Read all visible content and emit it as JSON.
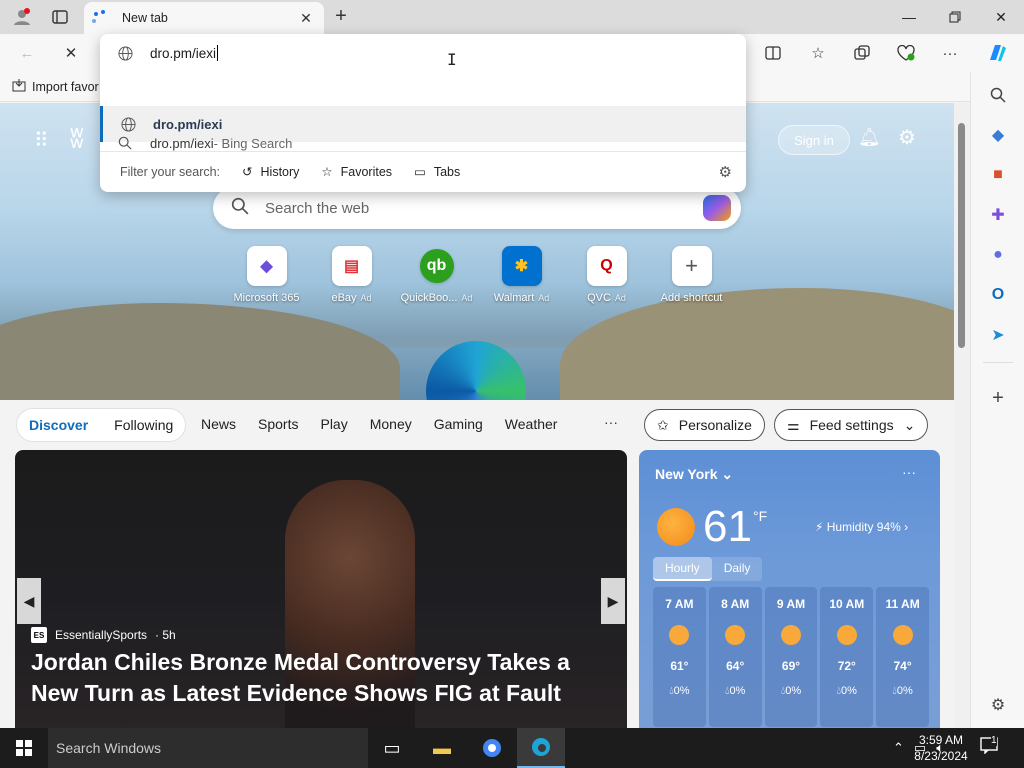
{
  "window": {
    "tab_title": "New tab",
    "new_tab_symbol": "+",
    "close_symbol": "✕"
  },
  "toolbar": {
    "back_symbol": "←",
    "stop_symbol": "✕",
    "more_symbol": "···"
  },
  "favorites_bar": {
    "import_label": "Import favor"
  },
  "omnibox": {
    "input_value": "dro.pm/iexi",
    "suggestions": [
      {
        "text": "dro.pm/iexi",
        "sub": ""
      },
      {
        "text": "dro.pm/iexi",
        "sub": " - Bing Search"
      }
    ],
    "filter_label": "Filter your search:",
    "filters": [
      "History",
      "Favorites",
      "Tabs"
    ]
  },
  "newtab": {
    "signin_label": "Sign in",
    "search_placeholder": "Search the web",
    "tiles": [
      {
        "label": "Microsoft 365",
        "ad": "",
        "glyph": "◆",
        "color": "#6b4fd8"
      },
      {
        "label": "eBay",
        "ad": "Ad",
        "glyph": "▤",
        "color": "#e53238"
      },
      {
        "label": "QuickBoo...",
        "ad": "Ad",
        "glyph": "qb",
        "color": "#2ca01c"
      },
      {
        "label": "Walmart",
        "ad": "Ad",
        "glyph": "✱",
        "color": "#0071ce"
      },
      {
        "label": "QVC",
        "ad": "Ad",
        "glyph": "Q",
        "color": "#c00"
      },
      {
        "label": "Add shortcut",
        "ad": "",
        "glyph": "+",
        "color": "#555"
      }
    ]
  },
  "feed": {
    "tabs": [
      "Discover",
      "Following"
    ],
    "links": [
      "News",
      "Sports",
      "Play",
      "Money",
      "Gaming",
      "Weather"
    ],
    "more": "···",
    "personalize": "Personalize",
    "feed_settings": "Feed settings"
  },
  "news": {
    "source": "EssentiallySports",
    "source_logo": "ES",
    "age": "· 5h",
    "headline": "Jordan Chiles Bronze Medal Controversy Takes a New Turn as Latest Evidence Shows FIG at Fault"
  },
  "weather": {
    "city": "New York",
    "temp": "61",
    "unit": "°F",
    "humidity": "Humidity 94%",
    "toggle": [
      "Hourly",
      "Daily"
    ],
    "hours": [
      {
        "time": "7 AM",
        "temp": "61°",
        "precip": "0%"
      },
      {
        "time": "8 AM",
        "temp": "64°",
        "precip": "0%"
      },
      {
        "time": "9 AM",
        "temp": "69°",
        "precip": "0%"
      },
      {
        "time": "10 AM",
        "temp": "72°",
        "precip": "0%"
      },
      {
        "time": "11 AM",
        "temp": "74°",
        "precip": "0%"
      }
    ]
  },
  "taskbar": {
    "search_placeholder": "Search Windows",
    "time": "3:59 AM",
    "date": "8/23/2024",
    "notification_count": "1"
  }
}
